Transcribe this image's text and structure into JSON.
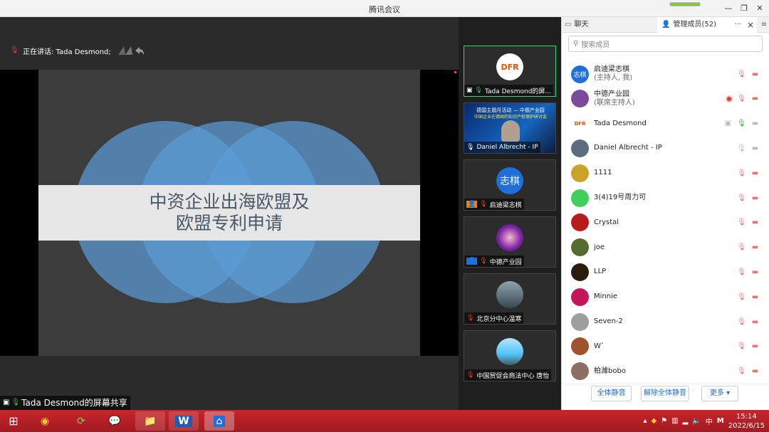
{
  "app": {
    "title": "腾讯会议"
  },
  "speaking": {
    "label": "正在讲话: Tada Desmond;"
  },
  "slide": {
    "line1": "中资企业出海欧盟及",
    "line2": "欧盟专利申请"
  },
  "share_label": "Tada Desmond的屏幕共享",
  "thumbnails": [
    {
      "logo_text": "DFR",
      "label": "Tada Desmond的屏..."
    },
    {
      "banner_line1": "德国主题月活动 — 中德产业园",
      "banner_line2": "中国企业在德国的知识产权保护研讨会",
      "label": "Daniel Albrecht - IP"
    },
    {
      "avatar_text": "志棋",
      "label": "启迪梁志棋"
    },
    {
      "label": "中德产业园"
    },
    {
      "label": "北京分中心温寒"
    },
    {
      "label": "中国贸促会商法中心 唐怡"
    }
  ],
  "panel": {
    "chat_tab": "聊天",
    "members_tab": "管理成员(52)",
    "more": "···",
    "close": "×",
    "search_placeholder": "搜索成员",
    "members": [
      {
        "name": "启迪梁志棋",
        "role": "(主持人, 我)",
        "avatar": "志棋",
        "color": "#1e6fd9"
      },
      {
        "name": "中德产业园",
        "role": "(联席主持人)",
        "avatar": "",
        "color": "#7b4b9a"
      },
      {
        "name": "Tada Desmond",
        "role": "",
        "avatar": "DFR",
        "color": "#ffffff"
      },
      {
        "name": "Daniel Albrecht - IP",
        "role": "",
        "avatar": "",
        "color": "#5d6d7e"
      },
      {
        "name": "1111",
        "role": "",
        "avatar": "",
        "color": "#c9a227"
      },
      {
        "name": "3(4)19号周力可",
        "role": "",
        "avatar": "",
        "color": "#3ecf5c"
      },
      {
        "name": "Crystal",
        "role": "",
        "avatar": "",
        "color": "#b71c1c"
      },
      {
        "name": "joe",
        "role": "",
        "avatar": "",
        "color": "#556b2f"
      },
      {
        "name": "LLP",
        "role": "",
        "avatar": "",
        "color": "#2a1d10"
      },
      {
        "name": "Minnie",
        "role": "",
        "avatar": "",
        "color": "#c2185b"
      },
      {
        "name": "Seven-2",
        "role": "",
        "avatar": "",
        "color": "#9e9e9e"
      },
      {
        "name": "W`",
        "role": "",
        "avatar": "",
        "color": "#a0522d"
      },
      {
        "name": "柏濰bobo",
        "role": "",
        "avatar": "",
        "color": "#8d6e63"
      }
    ],
    "mute_all": "全体静音",
    "unmute_all": "解除全体静音",
    "more_btn": "更多 ▾"
  },
  "taskbar": {
    "time": "15:14",
    "date": "2022/6/15",
    "ime": "中"
  }
}
